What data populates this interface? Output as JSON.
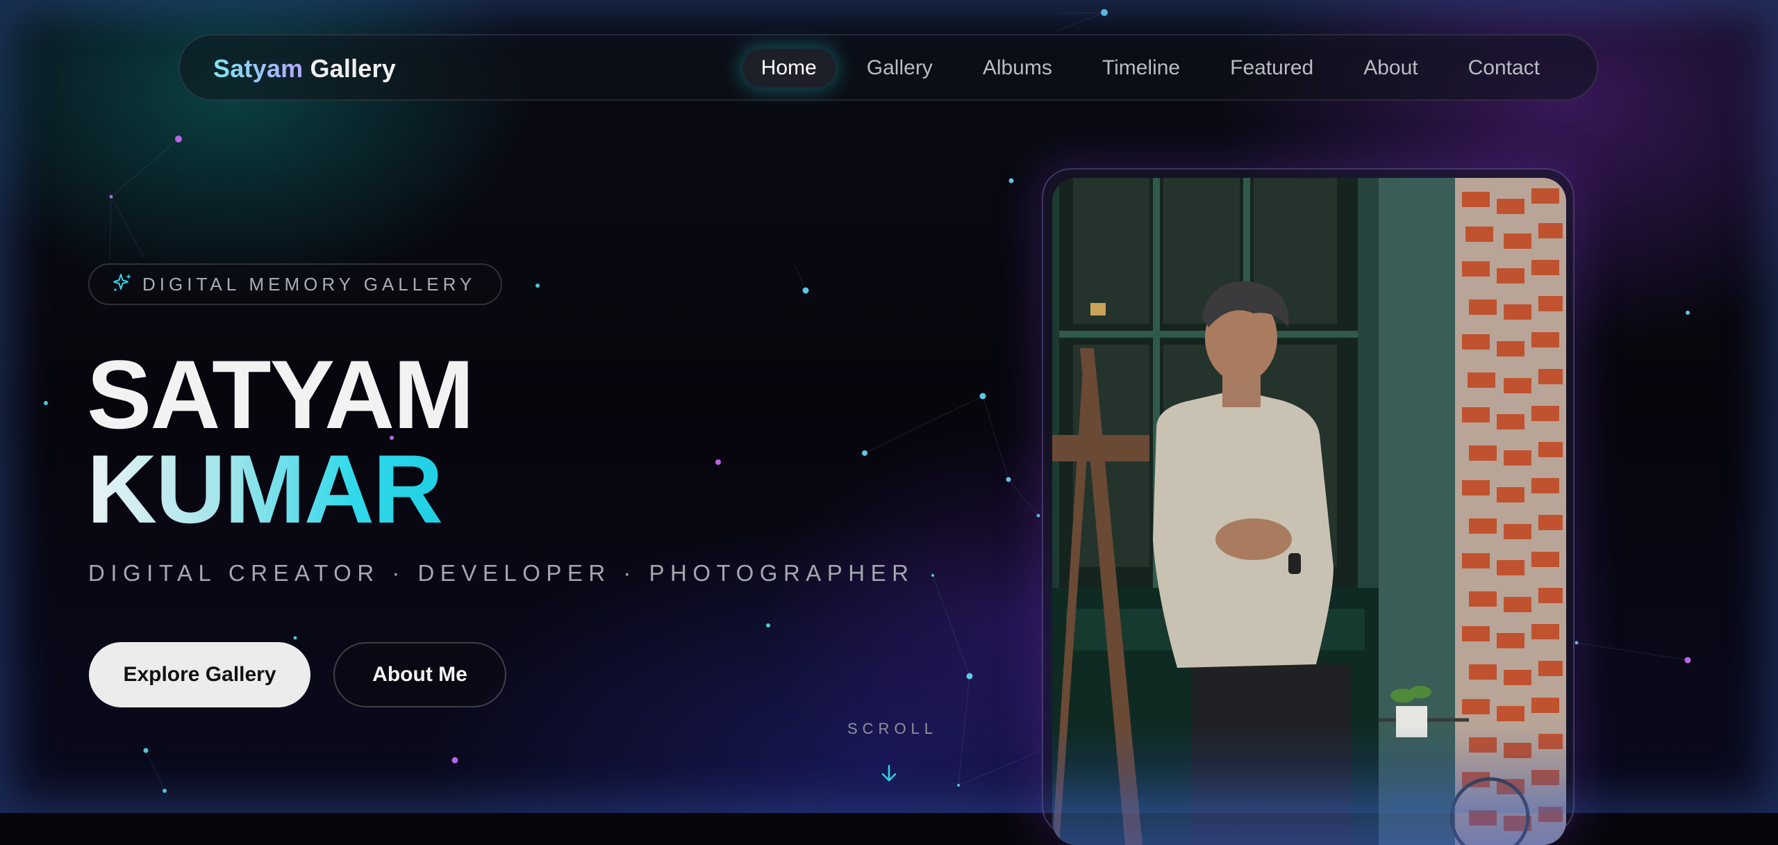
{
  "nav": {
    "brand_first": "Satyam",
    "brand_second": "Gallery",
    "links": [
      "Home",
      "Gallery",
      "Albums",
      "Timeline",
      "Featured",
      "About",
      "Contact"
    ],
    "active": "Home"
  },
  "hero": {
    "badge_icon": "sparkle-icon",
    "badge_text": "DIGITAL MEMORY GALLERY",
    "name_line1": "SATYAM",
    "name_line2": "KUMAR",
    "tagline": "DIGITAL CREATOR · DEVELOPER · PHOTOGRAPHER",
    "primary_button": "Explore Gallery",
    "secondary_button": "About Me",
    "scroll_label": "SCROLL",
    "scroll_icon": "arrow-down-icon"
  },
  "colors": {
    "accent_cyan": "#2fd6e8",
    "accent_purple": "#b4a6ff",
    "background": "#07060c"
  }
}
